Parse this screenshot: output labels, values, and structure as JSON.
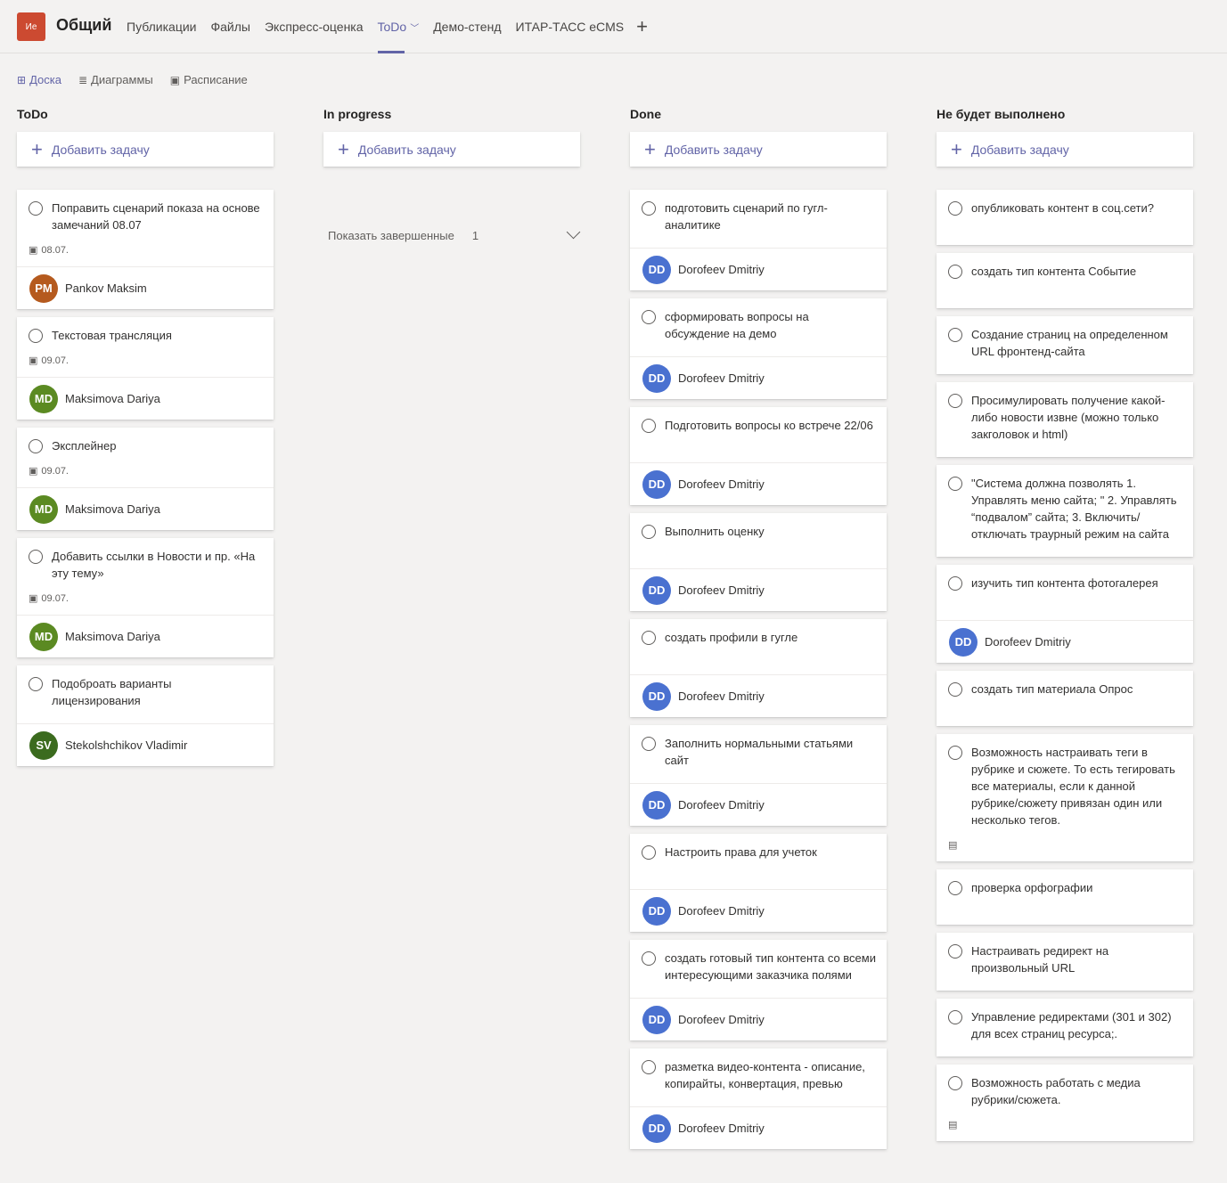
{
  "header": {
    "team_avatar": "Ие",
    "channel": "Общий",
    "tabs": [
      {
        "label": "Публикации",
        "active": false
      },
      {
        "label": "Файлы",
        "active": false
      },
      {
        "label": "Экспресс-оценка",
        "active": false
      },
      {
        "label": "ToDo",
        "active": true,
        "dropdown": true
      },
      {
        "label": "Демо-стенд",
        "active": false
      },
      {
        "label": "ИТАР-ТАСС eCMS",
        "active": false
      }
    ],
    "add_tab_icon": "plus-icon"
  },
  "subnav": [
    {
      "label": "Доска",
      "icon": "board-icon",
      "active": true
    },
    {
      "label": "Диаграммы",
      "icon": "chart-icon",
      "active": false
    },
    {
      "label": "Расписание",
      "icon": "calendar-icon",
      "active": false
    }
  ],
  "add_task_label": "Добавить задачу",
  "colors": {
    "accent": "#6264a7",
    "team_avatar": "#cc4a31",
    "PM": "#b55a1e",
    "MD": "#5b8a22",
    "SV": "#3b6b1e",
    "DD": "#4a71d0"
  },
  "columns": [
    {
      "title": "ToDo",
      "tasks": [
        {
          "text": "Поправить сценарий показа на основе замечаний 08.07",
          "due": "08.07.",
          "assignee": {
            "initials": "PM",
            "name": "Pankov Maksim"
          }
        },
        {
          "text": "Текстовая трансляция",
          "due": "09.07.",
          "assignee": {
            "initials": "MD",
            "name": "Maksimova Dariya"
          }
        },
        {
          "text": "Эксплейнер",
          "due": "09.07.",
          "assignee": {
            "initials": "MD",
            "name": "Maksimova Dariya"
          }
        },
        {
          "text": "Добавить ссылки в Новости и пр. «На эту тему»",
          "due": "09.07.",
          "assignee": {
            "initials": "MD",
            "name": "Maksimova Dariya"
          }
        },
        {
          "text": "Подоброать варианты лицензирования",
          "assignee": {
            "initials": "SV",
            "name": "Stekolshchikov Vladimir"
          }
        }
      ]
    },
    {
      "title": "In progress",
      "tasks": [],
      "show_completed": {
        "label": "Показать завершенные",
        "count": "1"
      }
    },
    {
      "title": "Done",
      "tasks": [
        {
          "text": "подготовить сценарий по гугл-аналитике",
          "assignee": {
            "initials": "DD",
            "name": "Dorofeev Dmitriy"
          }
        },
        {
          "text": "сформировать вопросы на обсуждение на демо",
          "assignee": {
            "initials": "DD",
            "name": "Dorofeev Dmitriy"
          }
        },
        {
          "text": "Подготовить вопросы ко встрече 22/06",
          "assignee": {
            "initials": "DD",
            "name": "Dorofeev Dmitriy"
          }
        },
        {
          "text": "Выполнить оценку",
          "assignee": {
            "initials": "DD",
            "name": "Dorofeev Dmitriy"
          }
        },
        {
          "text": "создать профили в гугле",
          "assignee": {
            "initials": "DD",
            "name": "Dorofeev Dmitriy"
          }
        },
        {
          "text": "Заполнить нормальными статьями сайт",
          "assignee": {
            "initials": "DD",
            "name": "Dorofeev Dmitriy"
          }
        },
        {
          "text": "Настроить права для учеток",
          "assignee": {
            "initials": "DD",
            "name": "Dorofeev Dmitriy"
          }
        },
        {
          "text": "создать готовый тип контента со всеми интересующими заказчика полями",
          "assignee": {
            "initials": "DD",
            "name": "Dorofeev Dmitriy"
          }
        },
        {
          "text": "разметка видео-контента - описание, копирайты, конвертация, превью",
          "assignee": {
            "initials": "DD",
            "name": "Dorofeev Dmitriy"
          }
        }
      ]
    },
    {
      "title": "Не будет выполнено",
      "tasks": [
        {
          "text": "опубликовать контент в соц.сети?"
        },
        {
          "text": "создать тип контента Событие"
        },
        {
          "text": "Создание страниц на определенном URL фронтенд-сайта"
        },
        {
          "text": "Просимулировать получение какой-либо новости извне (можно только закголовок и html)"
        },
        {
          "text": "\"Система должна позволять 1. Управлять меню сайта; \" 2. Управлять “подвалом” сайта; 3. Включить/отключать траурный режим на сайта"
        },
        {
          "text": "изучить тип контента фотогалерея",
          "assignee": {
            "initials": "DD",
            "name": "Dorofeev Dmitriy"
          }
        },
        {
          "text": "создать тип материала Опрос"
        },
        {
          "text": "Возможность настраивать теги в рубрике и сюжете. То есть тегировать все материалы, если к данной рубрике/сюжету привязан один или несколько тегов.",
          "has_notes": true
        },
        {
          "text": "проверка орфографии"
        },
        {
          "text": "Настраивать редирект на произвольный URL"
        },
        {
          "text": "Управление редиректами (301 и 302) для всех страниц ресурса;."
        },
        {
          "text": "Возможность работать с медиа рубрики/сюжета.",
          "has_notes": true
        }
      ]
    }
  ]
}
